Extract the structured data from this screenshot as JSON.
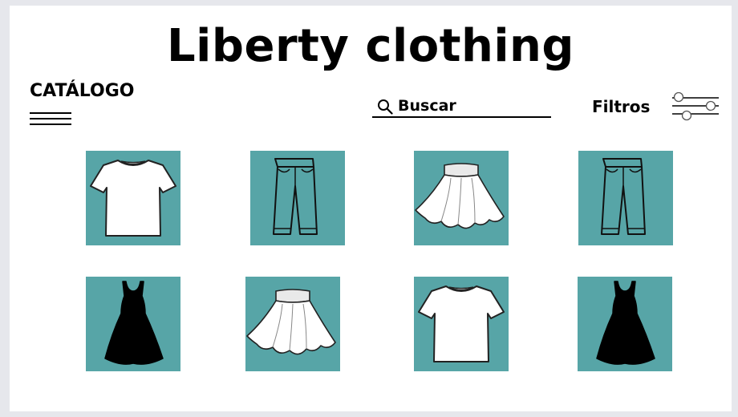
{
  "app": {
    "title": "Liberty clothing",
    "tile_color": "#57a5a7"
  },
  "header": {
    "catalog_label": "CATÁLOGO",
    "menu_icon": "hamburger-menu-icon"
  },
  "search": {
    "placeholder": "Buscar",
    "value": "",
    "icon": "search-icon"
  },
  "filters": {
    "label": "Filtros",
    "icon": "filter-sliders-icon"
  },
  "catalog": {
    "items": [
      {
        "product": "tshirt-white"
      },
      {
        "product": "pants"
      },
      {
        "product": "skirt-white"
      },
      {
        "product": "pants"
      },
      {
        "product": "dress-black"
      },
      {
        "product": "skirt-white"
      },
      {
        "product": "tshirt-white"
      },
      {
        "product": "dress-black"
      }
    ]
  }
}
